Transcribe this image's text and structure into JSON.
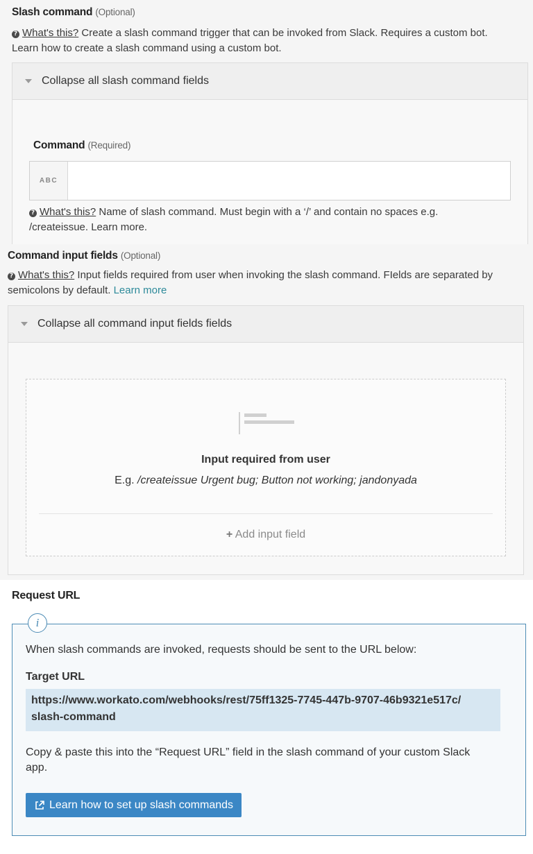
{
  "slash_command": {
    "label": "Slash command",
    "optional": "(Optional)",
    "help_link": "What's this?",
    "help_text_1": "Create a slash command trigger that can be invoked from Slack. Requires a custom bot.",
    "help_text_2": "Learn how to create a slash command using a custom bot.",
    "collapse_label": "Collapse all slash command fields",
    "command_label": "Command",
    "command_required": "(Required)",
    "input_type": "ABC",
    "command_value": "",
    "command_help_link": "What's this?",
    "command_help_1": "Name of slash command. Must begin with a ‘/’ and contain no spaces e.g.",
    "command_help_2": "/createissue. Learn more."
  },
  "input_fields": {
    "label": "Command input fields",
    "optional": "(Optional)",
    "help_link": "What's this?",
    "help_text_1": "Input fields required from user when invoking the slash command. FIelds are separated by",
    "help_text_2": "semicolons by default.",
    "learn_more": "Learn more",
    "collapse_label": "Collapse all command input fields fields",
    "empty_title": "Input required from user",
    "example_prefix": "E.g.",
    "example_value": "/createissue Urgent bug; Button not working; jandonyada",
    "add_label": "Add input field"
  },
  "request_url": {
    "label": "Request URL",
    "info_glyph": "i",
    "info_text": "When slash commands are invoked, requests should be sent to the URL below:",
    "target_label": "Target URL",
    "url_line_1": "https://www.workato.com/webhooks/rest/75ff1325-7745-447b-9707-46b9321e517c/",
    "url_line_2": "slash-command",
    "copy_text_1": "Copy & paste this into the “Request URL” field in the slash command of your custom Slack",
    "copy_text_2": "app.",
    "button_label": "Learn how to set up slash commands"
  },
  "colors": {
    "accent_blue": "#3b87c5",
    "info_border": "#4d8cb5",
    "url_background": "#d7e7f2",
    "link_teal": "#2d8a9a"
  },
  "icons": [
    "question-circle-icon",
    "caret-down-icon",
    "text-lines-icon",
    "plus-icon",
    "info-icon",
    "external-link-icon"
  ]
}
